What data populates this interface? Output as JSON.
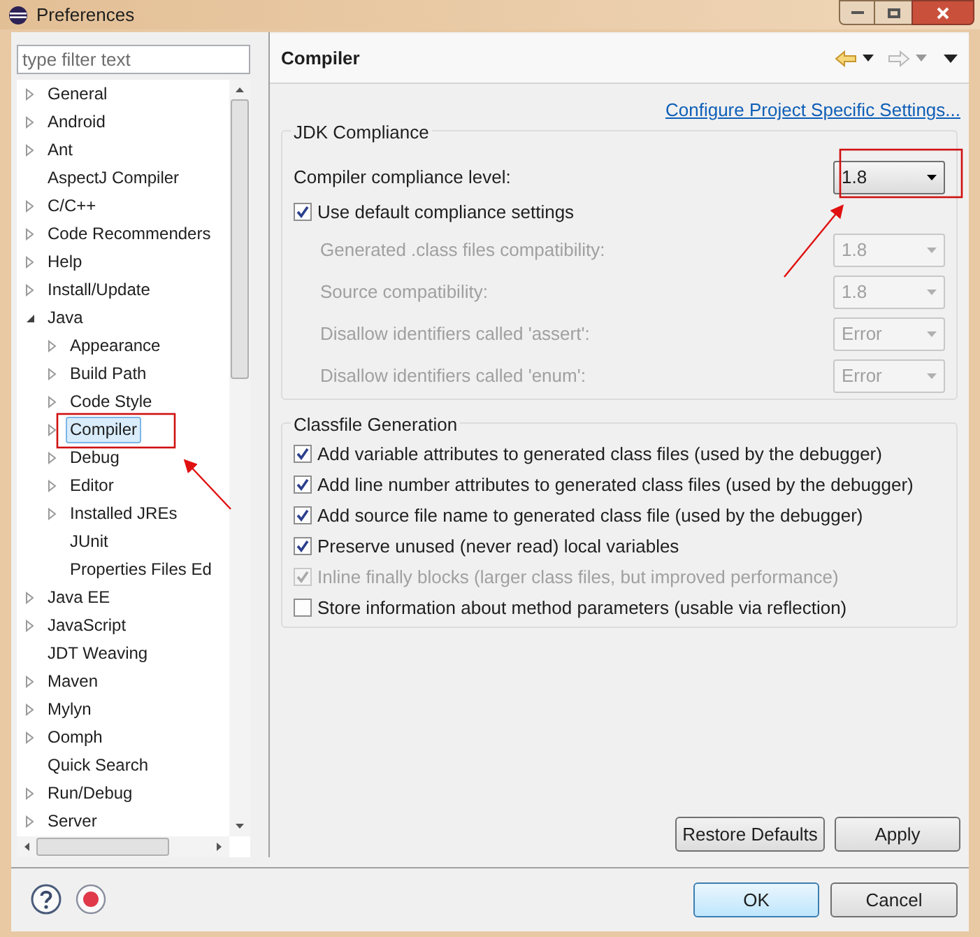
{
  "window": {
    "title": "Preferences"
  },
  "filter": {
    "placeholder": "type filter text"
  },
  "tree": [
    {
      "label": "General",
      "kind": "folder",
      "expanded": false,
      "selected": false
    },
    {
      "label": "Android",
      "kind": "folder",
      "expanded": false,
      "selected": false
    },
    {
      "label": "Ant",
      "kind": "folder",
      "expanded": false,
      "selected": false
    },
    {
      "label": "AspectJ Compiler",
      "kind": "leaf",
      "selected": false
    },
    {
      "label": "C/C++",
      "kind": "folder",
      "expanded": false,
      "selected": false
    },
    {
      "label": "Code Recommenders",
      "kind": "folder",
      "expanded": false,
      "selected": false
    },
    {
      "label": "Help",
      "kind": "folder",
      "expanded": false,
      "selected": false
    },
    {
      "label": "Install/Update",
      "kind": "folder",
      "expanded": false,
      "selected": false
    },
    {
      "label": "Java",
      "kind": "folder",
      "expanded": true,
      "selected": false,
      "children": [
        {
          "label": "Appearance",
          "kind": "folder",
          "expanded": false,
          "selected": false
        },
        {
          "label": "Build Path",
          "kind": "folder",
          "expanded": false,
          "selected": false
        },
        {
          "label": "Code Style",
          "kind": "folder",
          "expanded": false,
          "selected": false
        },
        {
          "label": "Compiler",
          "kind": "folder",
          "expanded": false,
          "selected": true
        },
        {
          "label": "Debug",
          "kind": "folder",
          "expanded": false,
          "selected": false
        },
        {
          "label": "Editor",
          "kind": "folder",
          "expanded": false,
          "selected": false
        },
        {
          "label": "Installed JREs",
          "kind": "folder",
          "expanded": false,
          "selected": false
        },
        {
          "label": "JUnit",
          "kind": "leaf",
          "selected": false
        },
        {
          "label": "Properties Files Ed",
          "kind": "leaf",
          "selected": false
        }
      ]
    },
    {
      "label": "Java EE",
      "kind": "folder",
      "expanded": false,
      "selected": false
    },
    {
      "label": "JavaScript",
      "kind": "folder",
      "expanded": false,
      "selected": false
    },
    {
      "label": "JDT Weaving",
      "kind": "leaf",
      "selected": false
    },
    {
      "label": "Maven",
      "kind": "folder",
      "expanded": false,
      "selected": false
    },
    {
      "label": "Mylyn",
      "kind": "folder",
      "expanded": false,
      "selected": false
    },
    {
      "label": "Oomph",
      "kind": "folder",
      "expanded": false,
      "selected": false
    },
    {
      "label": "Quick Search",
      "kind": "leaf",
      "selected": false
    },
    {
      "label": "Run/Debug",
      "kind": "folder",
      "expanded": false,
      "selected": false
    },
    {
      "label": "Server",
      "kind": "folder",
      "expanded": false,
      "selected": false
    }
  ],
  "page": {
    "title": "Compiler",
    "link": "Configure Project Specific Settings..."
  },
  "jdk_compliance": {
    "title": "JDK Compliance",
    "level": {
      "label": "Compiler compliance level:",
      "value": "1.8"
    },
    "use_default": {
      "label": "Use default compliance settings",
      "checked": true
    },
    "settings": [
      {
        "label": "Generated .class files compatibility:",
        "value": "1.8",
        "disabled": true
      },
      {
        "label": "Source compatibility:",
        "value": "1.8",
        "disabled": true
      },
      {
        "label": "Disallow identifiers called 'assert':",
        "value": "Error",
        "disabled": true
      },
      {
        "label": "Disallow identifiers called 'enum':",
        "value": "Error",
        "disabled": true
      }
    ]
  },
  "classfile_generation": {
    "title": "Classfile Generation",
    "options": [
      {
        "label": "Add variable attributes to generated class files (used by the debugger)",
        "checked": true,
        "disabled": false
      },
      {
        "label": "Add line number attributes to generated class files (used by the debugger)",
        "checked": true,
        "disabled": false
      },
      {
        "label": "Add source file name to generated class file (used by the debugger)",
        "checked": true,
        "disabled": false
      },
      {
        "label": "Preserve unused (never read) local variables",
        "checked": true,
        "disabled": false
      },
      {
        "label": "Inline finally blocks (larger class files, but improved performance)",
        "checked": true,
        "disabled": true
      },
      {
        "label": "Store information about method parameters (usable via reflection)",
        "checked": false,
        "disabled": false
      }
    ]
  },
  "page_buttons": [
    {
      "label": "Restore Defaults",
      "focused": false
    },
    {
      "label": "Apply",
      "focused": false
    }
  ],
  "dialog_buttons": [
    {
      "label": "OK",
      "focused": true
    },
    {
      "label": "Cancel",
      "focused": false
    }
  ]
}
